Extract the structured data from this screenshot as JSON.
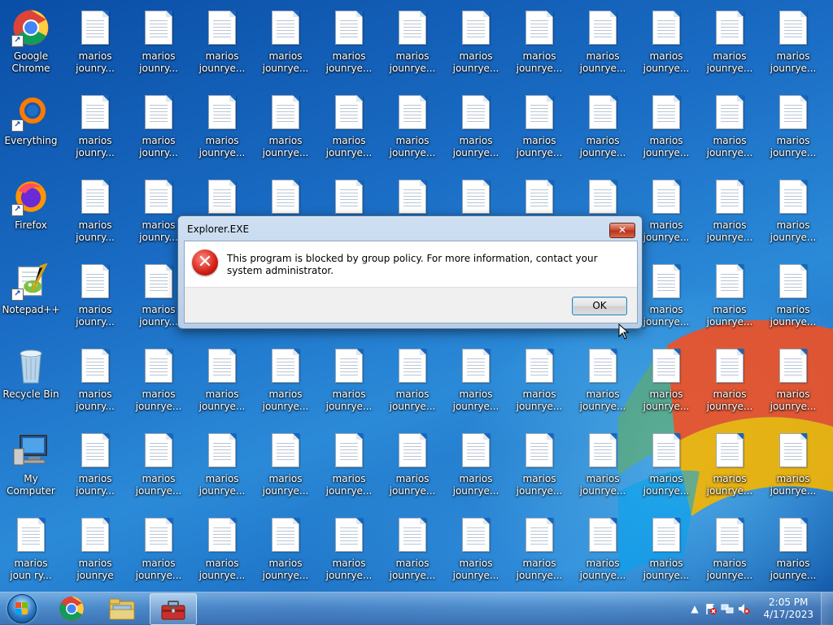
{
  "desktop": {
    "system_icons": [
      {
        "label": "Google\nChrome",
        "icon": "chrome-icon"
      },
      {
        "label": "Everything",
        "icon": "everything-icon"
      },
      {
        "label": "Firefox",
        "icon": "firefox-icon"
      },
      {
        "label": "Notepad++",
        "icon": "notepadpp-icon"
      },
      {
        "label": "Recycle Bin",
        "icon": "recycle-bin-icon"
      },
      {
        "label": "My Computer",
        "icon": "my-computer-icon"
      },
      {
        "label": "marios\njoun ry...",
        "icon": "document-icon"
      }
    ],
    "file_labels": {
      "col1": "marios\njounry...",
      "col2": "marios\njounry...",
      "other": "marios\njounrye...",
      "row7_col1": "marios\njounrye"
    }
  },
  "dialog": {
    "title": "Explorer.EXE",
    "message": "This program is blocked by group policy. For more information, contact your system administrator.",
    "ok_label": "OK",
    "close_label": "✕"
  },
  "taskbar": {
    "pinned": [
      "start-button",
      "chrome-taskbar-icon",
      "explorer-taskbar-icon",
      "toolbox-taskbar-icon"
    ],
    "clock_time": "2:05 PM",
    "clock_date": "4/17/2023",
    "tray_arrow": "▲"
  }
}
